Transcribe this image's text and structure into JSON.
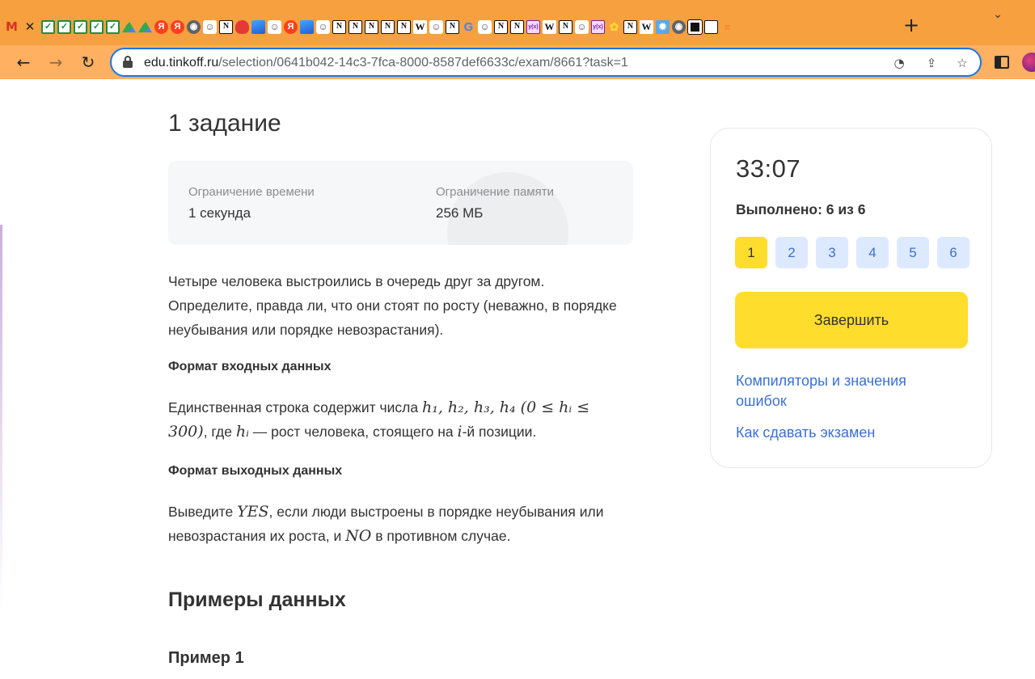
{
  "browser": {
    "tabs": [
      {
        "icon": "gmail-icon",
        "glyph": "M"
      },
      {
        "icon": "close-icon",
        "glyph": "✕"
      },
      {
        "icon": "checkbox-icon",
        "glyph": "✓"
      },
      {
        "icon": "checkbox-icon",
        "glyph": "✓"
      },
      {
        "icon": "checkbox-icon",
        "glyph": "✓"
      },
      {
        "icon": "checkbox-icon",
        "glyph": "✓"
      },
      {
        "icon": "checkbox-icon",
        "glyph": "✓"
      },
      {
        "icon": "drive-icon",
        "glyph": ""
      },
      {
        "icon": "drive-icon",
        "glyph": ""
      },
      {
        "icon": "yandex-icon",
        "glyph": "Я"
      },
      {
        "icon": "yandex-icon",
        "glyph": "Я"
      },
      {
        "icon": "globe-icon",
        "glyph": "◉"
      },
      {
        "icon": "avatar-icon",
        "glyph": "☺"
      },
      {
        "icon": "notion-icon",
        "glyph": "N"
      },
      {
        "icon": "red-blob-icon",
        "glyph": ""
      },
      {
        "icon": "blue-image-icon",
        "glyph": ""
      },
      {
        "icon": "avatar-icon",
        "glyph": "☺"
      },
      {
        "icon": "yandex-icon",
        "glyph": "Я"
      },
      {
        "icon": "blue-image-icon",
        "glyph": ""
      },
      {
        "icon": "avatar-icon",
        "glyph": "☺"
      },
      {
        "icon": "notion-icon",
        "glyph": "N"
      },
      {
        "icon": "notion-icon",
        "glyph": "N"
      },
      {
        "icon": "notion-icon",
        "glyph": "N"
      },
      {
        "icon": "notion-icon",
        "glyph": "N"
      },
      {
        "icon": "notion-icon",
        "glyph": "N"
      },
      {
        "icon": "wikipedia-icon",
        "glyph": "W"
      },
      {
        "icon": "avatar-icon",
        "glyph": "☺"
      },
      {
        "icon": "notion-icon",
        "glyph": "N"
      },
      {
        "icon": "google-icon",
        "glyph": "G"
      },
      {
        "icon": "avatar-icon",
        "glyph": "☺"
      },
      {
        "icon": "notion-icon",
        "glyph": "N"
      },
      {
        "icon": "notion-icon",
        "glyph": "N"
      },
      {
        "icon": "yx-icon",
        "glyph": "y(x)"
      },
      {
        "icon": "wikipedia-icon",
        "glyph": "W"
      },
      {
        "icon": "notion-icon",
        "glyph": "N"
      },
      {
        "icon": "avatar-icon",
        "glyph": "☺"
      },
      {
        "icon": "yx-icon",
        "glyph": "y(x)"
      },
      {
        "icon": "flower-icon",
        "glyph": "✿"
      },
      {
        "icon": "notion-icon",
        "glyph": "N"
      },
      {
        "icon": "wikipedia-icon",
        "glyph": "W"
      },
      {
        "icon": "gear-icon",
        "glyph": "✹"
      },
      {
        "icon": "globe-icon",
        "glyph": "◉"
      },
      {
        "icon": "black-square-icon",
        "glyph": ""
      },
      {
        "icon": "square-icon",
        "glyph": ""
      },
      {
        "icon": "stackoverflow-icon",
        "glyph": "≡"
      }
    ],
    "new_tab": "+",
    "tab_search": "⌄",
    "back": "←",
    "forward": "→",
    "reload": "↻",
    "url_host": "edu.tinkoff.ru",
    "url_path": "/selection/0641b042-14c3-7fca-8000-8587def6633c/exam/8661?task=1",
    "omnibox_icons": {
      "performance": "◔",
      "share": "⇪",
      "bookmark": "☆"
    },
    "colors": {
      "tabstrip": "#f7a03f",
      "toolbar": "#ffb061",
      "focus_ring": "#1a73e8"
    }
  },
  "task": {
    "title": "1 задание",
    "limits": {
      "time_label": "Ограничение времени",
      "time_value": "1 секунда",
      "memory_label": "Ограничение памяти",
      "memory_value": "256 МБ"
    },
    "statement": "Четыре человека выстроились в очередь друг за другом. Определите, правда ли, что они стоят по росту (неважно, в порядке неубывания или порядке невозрастания).",
    "input_heading": "Формат входных данных",
    "input_text_1": "Единственная строка содержит числа ",
    "input_math_1": "h₁, h₂, h₃, h₄ (0 ≤ hᵢ ≤ 300)",
    "input_text_2": ", где ",
    "input_math_2": "hᵢ",
    "input_text_3": " — рост человека, стоящего на ",
    "input_math_3": "i",
    "input_text_4": "-й позиции.",
    "output_heading": "Формат выходных данных",
    "output_text_1": "Выведите ",
    "output_math_1": "YES",
    "output_text_2": ", если люди выстроены в порядке неубывания или невозрастания их роста, и ",
    "output_math_2": "NO",
    "output_text_3": " в противном случае.",
    "examples_title": "Примеры данных",
    "example_1_title": "Пример 1"
  },
  "sidebar": {
    "timer": "33:07",
    "progress": "Выполнено: 6 из 6",
    "tasks": [
      "1",
      "2",
      "3",
      "4",
      "5",
      "6"
    ],
    "current_task": "1",
    "finish_label": "Завершить",
    "link_compilers": "Компиляторы и значения ошибок",
    "link_howto": "Как сдавать экзамен",
    "colors": {
      "accent": "#ffdd2d",
      "task_button": "#dde9ff",
      "link": "#3b6fd6"
    }
  }
}
